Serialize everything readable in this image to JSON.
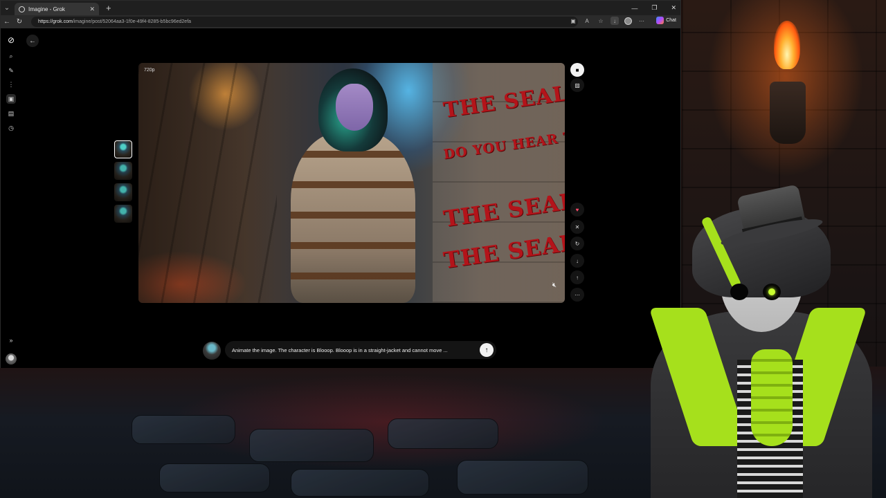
{
  "browser": {
    "tab_title": "Imagine - Grok",
    "new_tab": "+",
    "url_host": "https://grok.com",
    "url_path": "/imagine/post/52064aa3-1f0e-49f4-8285-b5bc96ed2efa",
    "copilot_label": "Chat",
    "window_controls": {
      "minimize": "—",
      "maximize": "❐",
      "close": "✕"
    }
  },
  "viewer": {
    "quality": "720p",
    "graffiti": [
      "THE SEALS!",
      "DO YOU HEAR THE BARKING?",
      "THE SEALS",
      "THE SEALS!"
    ]
  },
  "prompt": {
    "text": "Animate the image. The character is Blooop. Blooop is in a straight-jacket and cannot move ..."
  },
  "icons": {
    "back": "back-arrow-icon",
    "send": "arrow-up-icon",
    "mute": "muted-speaker-icon"
  },
  "colors": {
    "accent_green": "#a6e01c",
    "graffiti_red": "#b3141a",
    "heart": "#ff4a6a"
  }
}
